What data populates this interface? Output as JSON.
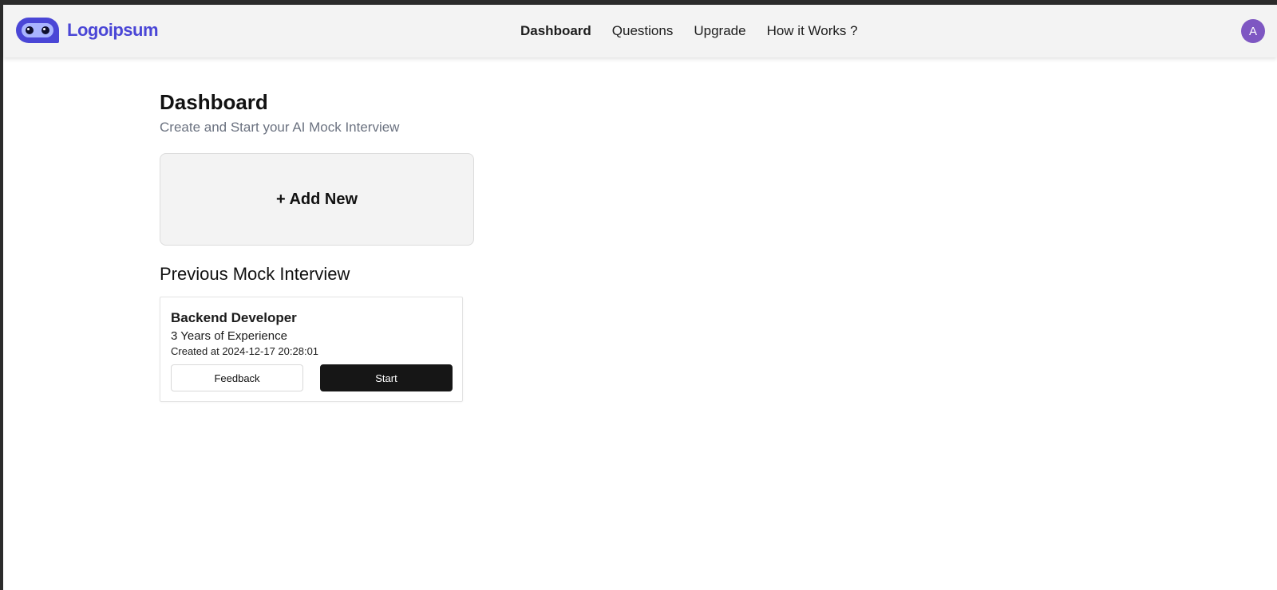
{
  "header": {
    "logo_text": "Logoipsum",
    "nav": [
      {
        "label": "Dashboard",
        "active": true
      },
      {
        "label": "Questions",
        "active": false
      },
      {
        "label": "Upgrade",
        "active": false
      },
      {
        "label": "How it Works ?",
        "active": false
      }
    ],
    "avatar_initial": "A"
  },
  "main": {
    "title": "Dashboard",
    "subtitle": "Create and Start your AI Mock Interview",
    "add_new_label": "+ Add New",
    "previous_title": "Previous Mock Interview",
    "interviews": [
      {
        "role": "Backend Developer",
        "experience": "3 Years of Experience",
        "created": "Created at 2024-12-17 20:28:01",
        "feedback_label": "Feedback",
        "start_label": "Start"
      }
    ]
  },
  "colors": {
    "brand": "#4a46d6",
    "avatar": "#7e57c2",
    "start_button": "#161616"
  },
  "icons": {
    "logo": "robot-logo-icon"
  }
}
